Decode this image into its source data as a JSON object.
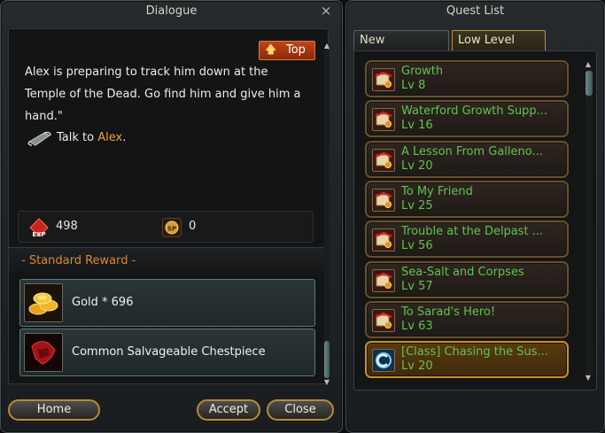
{
  "dialogue": {
    "title": "Dialogue",
    "close_icon": "×",
    "top_button": "Top",
    "text": "Alex is preparing to track him down at the Temple of the Dead. Go find him and give him a hand.\"",
    "talk_prefix": "Talk to ",
    "npc_name": "Alex",
    "talk_suffix": ".",
    "exp_value": "498",
    "sp_value": "0",
    "reward_header": "- Standard Reward -",
    "rewards": [
      {
        "label": "Gold * 696",
        "icon": "gold-coins-icon"
      },
      {
        "label": "Common Salvageable Chestpiece",
        "icon": "chestpiece-icon"
      }
    ],
    "buttons": {
      "home": "Home",
      "accept": "Accept",
      "close": "Close"
    }
  },
  "quest_list": {
    "title": "Quest List",
    "tabs": [
      {
        "label": "New",
        "active": false
      },
      {
        "label": "Low Level",
        "active": true
      }
    ],
    "quests": [
      {
        "name": "Growth",
        "level": "Lv 8",
        "icon": "quest-scroll-icon"
      },
      {
        "name": "Waterford Growth Supp...",
        "level": "Lv 16",
        "icon": "quest-scroll-icon"
      },
      {
        "name": "A Lesson From Galleno...",
        "level": "Lv 20",
        "icon": "quest-scroll-icon"
      },
      {
        "name": "To My Friend",
        "level": "Lv 25",
        "icon": "quest-scroll-icon"
      },
      {
        "name": "Trouble at the Delpast ...",
        "level": "Lv 56",
        "icon": "quest-scroll-icon"
      },
      {
        "name": "Sea-Salt and Corpses",
        "level": "Lv 57",
        "icon": "quest-scroll-icon"
      },
      {
        "name": "To Sarad's Hero!",
        "level": "Lv 63",
        "icon": "quest-scroll-icon"
      },
      {
        "name": "[Class] Chasing the Sus...",
        "level": "Lv 20",
        "icon": "class-quest-icon",
        "selected": true
      }
    ]
  },
  "colors": {
    "quest_text": "#5fc44c",
    "npc_highlight": "#e8a33a",
    "reward_header": "#d98a32",
    "frame_gold": "#b78b35"
  }
}
